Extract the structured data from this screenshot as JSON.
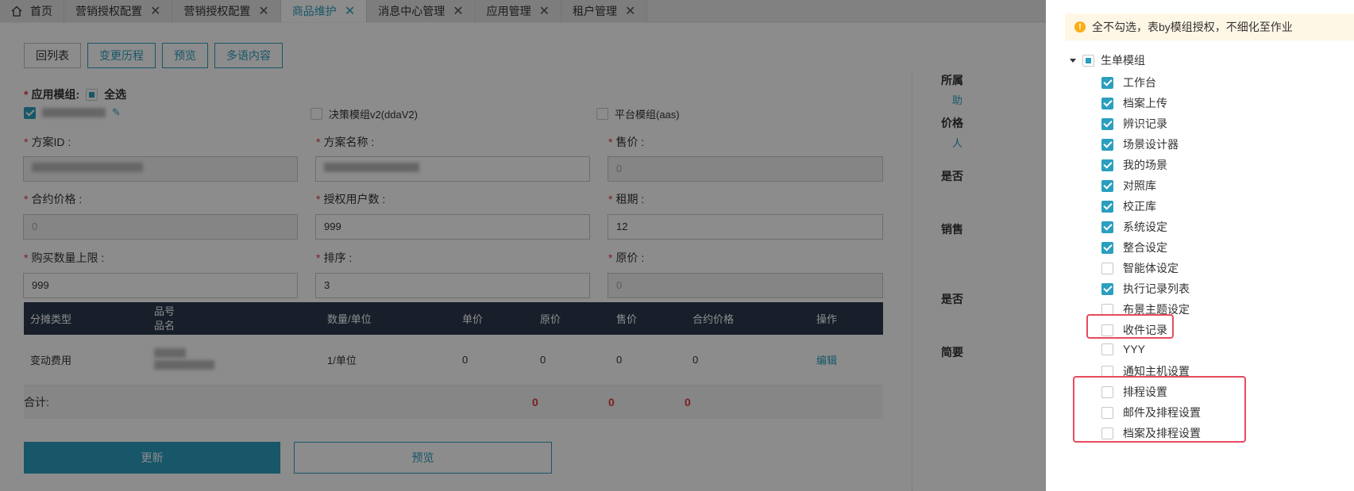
{
  "tabs": [
    {
      "label": "首页",
      "active": false,
      "closable": false
    },
    {
      "label": "营销授权配置",
      "active": false,
      "closable": true
    },
    {
      "label": "营销授权配置",
      "active": false,
      "closable": true
    },
    {
      "label": "商品维护",
      "active": true,
      "closable": true
    },
    {
      "label": "消息中心管理",
      "active": false,
      "closable": true
    },
    {
      "label": "应用管理",
      "active": false,
      "closable": true
    },
    {
      "label": "租户管理",
      "active": false,
      "closable": true
    }
  ],
  "toolbar": {
    "back": "回列表",
    "history": "变更历程",
    "preview": "预览",
    "i18n": "多语内容"
  },
  "form": {
    "module_label": "应用模组:",
    "select_all": "全选",
    "modules": [
      "决策模组v2(ddaV2)",
      "平台模组(aas)"
    ],
    "plan_id_label": "方案ID :",
    "plan_name_label": "方案名称 :",
    "price_label": "售价 :",
    "price_value": "0",
    "contract_price_label": "合约价格 :",
    "contract_price_value": "0",
    "users_label": "授权用户数 :",
    "users_value": "999",
    "lease_label": "租期 :",
    "lease_value": "12",
    "max_qty_label": "购买数量上限 :",
    "max_qty_value": "999",
    "sort_label": "排序 :",
    "sort_value": "3",
    "orig_price_label": "原价 :",
    "orig_price_value": "0"
  },
  "table": {
    "headers": [
      "分摊类型",
      "品号",
      "品名",
      "数量/单位",
      "单价",
      "原价",
      "售价",
      "合约价格",
      "操作"
    ],
    "row": {
      "type": "变动费用",
      "qty": "1/单位",
      "unit": "0",
      "orig": "0",
      "sale": "0",
      "contract": "0",
      "action": "编辑"
    },
    "total_label": "合计:",
    "totals": [
      "0",
      "0",
      "0"
    ]
  },
  "buttons": {
    "update": "更新",
    "preview": "预览"
  },
  "side": {
    "belong": "所属",
    "belong_val": "助",
    "price": "价格",
    "price_val": "人",
    "is": "是否",
    "sales": "销售",
    "is2": "是否",
    "summary": "简要"
  },
  "drawer": {
    "alert": "全不勾选，表by模组授权，不细化至作业",
    "root": "生单模组",
    "items": [
      {
        "label": "工作台",
        "checked": true
      },
      {
        "label": "档案上传",
        "checked": true
      },
      {
        "label": "辨识记录",
        "checked": true
      },
      {
        "label": "场景设计器",
        "checked": true
      },
      {
        "label": "我的场景",
        "checked": true
      },
      {
        "label": "对照库",
        "checked": true
      },
      {
        "label": "校正库",
        "checked": true
      },
      {
        "label": "系统设定",
        "checked": true
      },
      {
        "label": "整合设定",
        "checked": true
      },
      {
        "label": "智能体设定",
        "checked": false
      },
      {
        "label": "执行记录列表",
        "checked": true
      },
      {
        "label": "布景主题设定",
        "checked": false
      },
      {
        "label": "收件记录",
        "checked": false
      },
      {
        "label": "YYY",
        "checked": false
      },
      {
        "label": "通知主机设置",
        "checked": false
      },
      {
        "label": "排程设置",
        "checked": false
      },
      {
        "label": "邮件及排程设置",
        "checked": false
      },
      {
        "label": "档案及排程设置",
        "checked": false
      }
    ]
  },
  "colors": {
    "accent": "#2a9fbf",
    "highlight": "#e84a5f",
    "required": "#e23b3b"
  }
}
